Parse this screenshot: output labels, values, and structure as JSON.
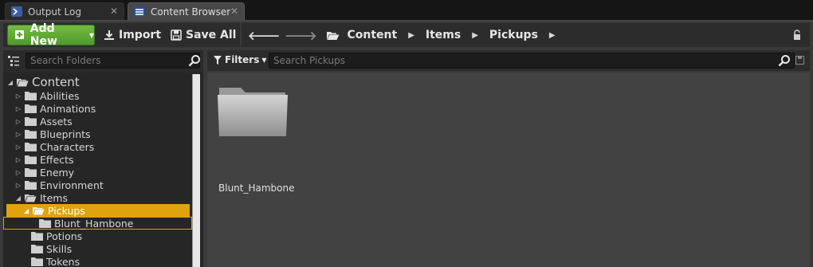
{
  "tabs": [
    {
      "label": "Output Log",
      "active": false
    },
    {
      "label": "Content Browser",
      "active": true
    }
  ],
  "toolbar": {
    "add_new_label": "Add New",
    "import_label": "Import",
    "save_all_label": "Save All"
  },
  "breadcrumb": [
    "Content",
    "Items",
    "Pickups"
  ],
  "sidebar": {
    "search_placeholder": "Search Folders",
    "tree": [
      {
        "label": "Content",
        "depth": 0,
        "expanded": true
      },
      {
        "label": "Abilities",
        "depth": 1
      },
      {
        "label": "Animations",
        "depth": 1
      },
      {
        "label": "Assets",
        "depth": 1
      },
      {
        "label": "Blueprints",
        "depth": 1
      },
      {
        "label": "Characters",
        "depth": 1
      },
      {
        "label": "Effects",
        "depth": 1
      },
      {
        "label": "Enemy",
        "depth": 1
      },
      {
        "label": "Environment",
        "depth": 1
      },
      {
        "label": "Items",
        "depth": 1,
        "expanded": true
      },
      {
        "label": "Pickups",
        "depth": 2,
        "expanded": true,
        "selected": true
      },
      {
        "label": "Blunt_Hambone",
        "depth": 3,
        "highlighted": true
      },
      {
        "label": "Potions",
        "depth": 2
      },
      {
        "label": "Skills",
        "depth": 2
      },
      {
        "label": "Tokens",
        "depth": 2
      }
    ]
  },
  "assets": {
    "filters_label": "Filters",
    "search_placeholder": "Search Pickups",
    "items": [
      {
        "label": "Blunt_Hambone",
        "type": "folder"
      }
    ]
  },
  "colors": {
    "accent_green": "#5ca835",
    "selection": "#e0a30d"
  }
}
